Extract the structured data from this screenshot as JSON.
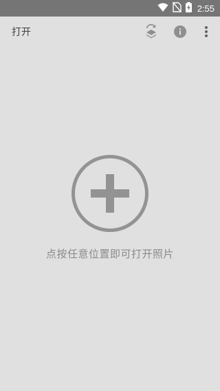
{
  "status_bar": {
    "time": "2:55",
    "icons": [
      "wifi-icon",
      "no-sim-icon",
      "battery-charging-icon"
    ],
    "background": "#757575"
  },
  "app_bar": {
    "title": "打开",
    "actions": [
      "layers-swap-icon",
      "info-icon",
      "more-vert-icon"
    ]
  },
  "main": {
    "add_icon": "add-circle-icon",
    "hint": "点按任意位置即可打开照片"
  },
  "colors": {
    "background": "#e0e0e0",
    "icon_gray": "#8f8f8f",
    "text": "#424242"
  }
}
